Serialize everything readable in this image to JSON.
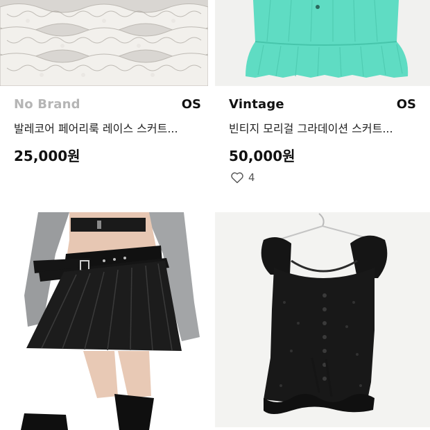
{
  "products": [
    {
      "brand": "No Brand",
      "brand_color": "#b5b5b5",
      "size": "OS",
      "title": "발레코어 페어리룩 레이스 스커트...",
      "price": "25,000원"
    },
    {
      "brand": "Vintage",
      "brand_color": "#111111",
      "size": "OS",
      "title": "빈티지 모리걸 그라데이션 스커트...",
      "price": "50,000원",
      "likes": "4",
      "likes_icon": "heart-outline-icon"
    },
    {
      "image_icon": "black-pleated-belted-skirt-photo"
    },
    {
      "image_icon": "black-eyelet-ruffle-top-photo"
    }
  ]
}
